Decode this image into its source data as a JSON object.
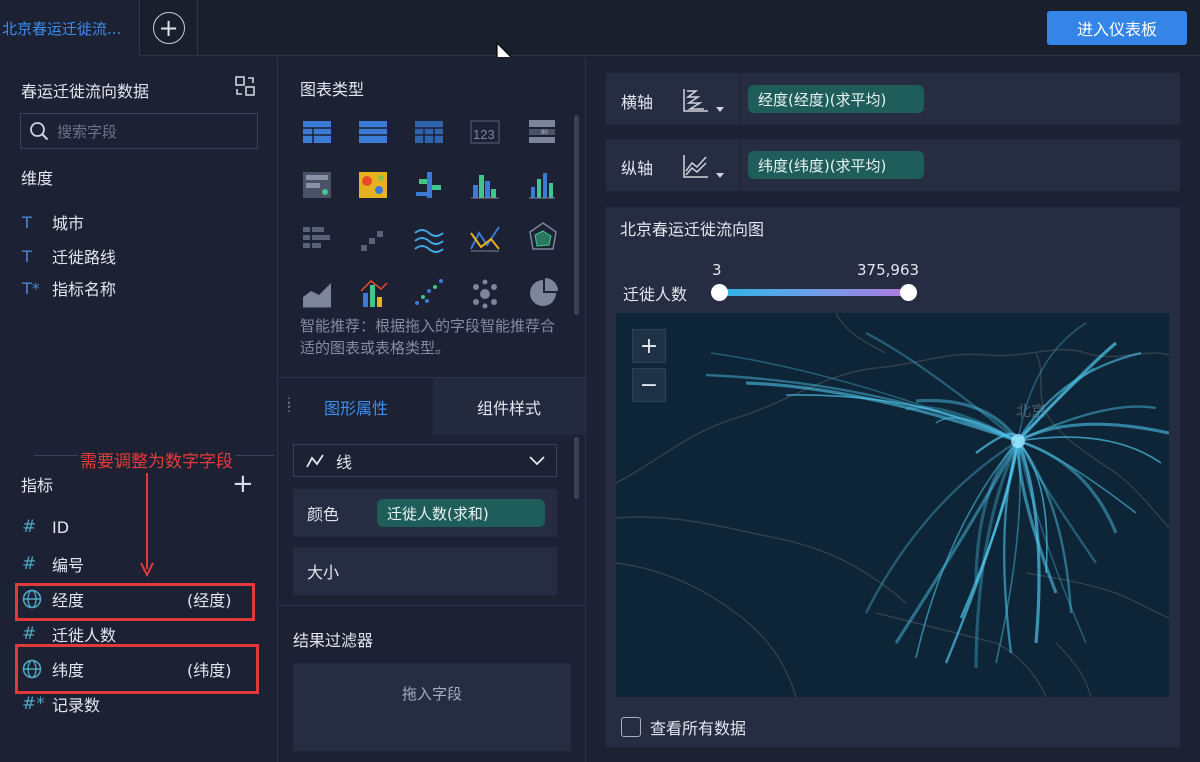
{
  "topbar": {
    "tab_title": "北京春运迁徙流...",
    "add_tab": "+",
    "dashboard_button": "进入仪表板"
  },
  "left": {
    "title": "春运迁徙流向数据",
    "search_placeholder": "搜索字段",
    "dimension_label": "维度",
    "dimensions": [
      {
        "type": "T",
        "label": "城市"
      },
      {
        "type": "T",
        "label": "迁徙路线"
      },
      {
        "type": "T*",
        "label": "指标名称"
      }
    ],
    "annotation": "需要调整为数字字段",
    "metric_label": "指标",
    "metrics": [
      {
        "type": "#",
        "label": "ID",
        "sub": ""
      },
      {
        "type": "#",
        "label": "编号",
        "sub": ""
      },
      {
        "type": "geo",
        "label": "经度",
        "sub": "(经度)"
      },
      {
        "type": "#",
        "label": "迁徙人数",
        "sub": ""
      },
      {
        "type": "geo",
        "label": "纬度",
        "sub": "(纬度)"
      },
      {
        "type": "#*",
        "label": "记录数",
        "sub": ""
      }
    ]
  },
  "middle": {
    "chart_type_title": "图表类型",
    "hint": "智能推荐：根据拖入的字段智能推荐合适的图表或表格类型。",
    "tab_shape": "图形属性",
    "tab_style": "组件样式",
    "shape_select": "线",
    "color_label": "颜色",
    "color_field": "迁徙人数(求和)",
    "size_label": "大小",
    "filter_title": "结果过滤器",
    "filter_drop": "拖入字段",
    "icon_123": "123",
    "icon_90": "90"
  },
  "right": {
    "x_axis_label": "横轴",
    "x_axis_field": "经度(经度)(求平均)",
    "y_axis_label": "纵轴",
    "y_axis_field": "纬度(纬度)(求平均)",
    "chart_title": "北京春运迁徙流向图",
    "range_label": "迁徙人数",
    "range_min": "3",
    "range_max": "375,963",
    "map_city": "北京",
    "zoom_in": "+",
    "zoom_out": "−",
    "show_all_data": "查看所有数据"
  },
  "colors": {
    "accent": "#3585e8",
    "pill": "#1f5d5a",
    "annotation": "#e03a3a",
    "flow_line": "#4fc3ea"
  }
}
